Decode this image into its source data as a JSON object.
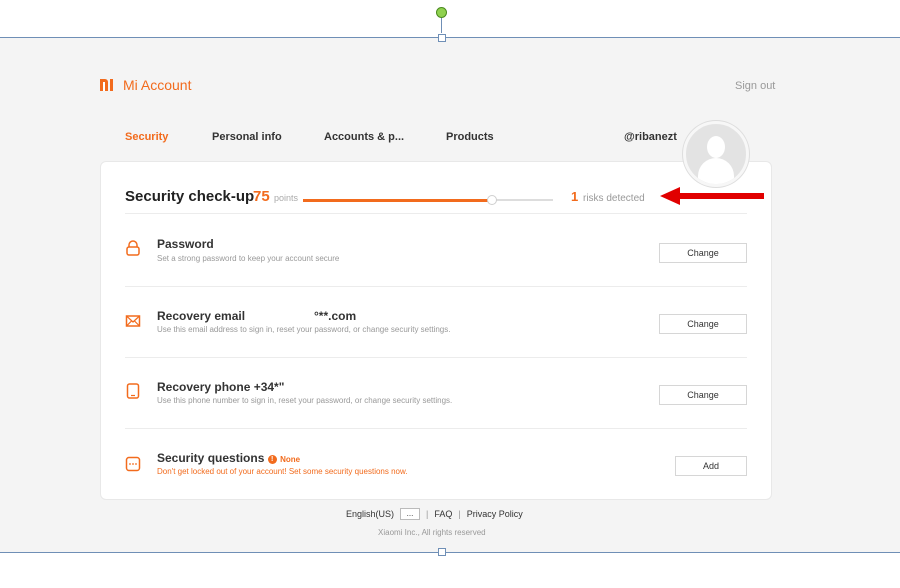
{
  "header": {
    "logo_text": "Mi Account",
    "sign_out": "Sign out",
    "username": "@ribanezt"
  },
  "tabs": [
    {
      "label": "Security",
      "active": true
    },
    {
      "label": "Personal info",
      "active": false
    },
    {
      "label": "Accounts & p...",
      "active": false
    },
    {
      "label": "Products",
      "active": false
    }
  ],
  "checkup": {
    "title": "Security check-up",
    "score": "75",
    "points_label": "points",
    "progress_fraction": 0.75,
    "risk_count": "1",
    "risk_label": "risks detected"
  },
  "rows": [
    {
      "title": "Password",
      "description": "Set a strong password to keep your account secure",
      "button": "Change",
      "icon": "lock-icon"
    },
    {
      "title": "Recovery email",
      "value": "°**.com",
      "description": "Use this email address to sign in, reset your password, or change security settings.",
      "button": "Change",
      "icon": "envelope-icon"
    },
    {
      "title": "Recovery phone +34*ʺ",
      "description": "Use this phone number to sign in, reset your password, or change security settings.",
      "button": "Change",
      "icon": "phone-icon"
    },
    {
      "title": "Security questions",
      "status": "None",
      "description": "Don't get locked out of your account! Set some security questions now.",
      "button": "Add",
      "icon": "message-icon"
    }
  ],
  "footer": {
    "language": "English(US)",
    "lang_menu": "...",
    "faq": "FAQ",
    "privacy": "Privacy Policy",
    "copyright": "Xiaomi Inc., All rights reserved",
    "separator": "|"
  },
  "colors": {
    "accent": "#f26b1d",
    "arrow": "#e10000",
    "frame": "#6f8fb6"
  }
}
